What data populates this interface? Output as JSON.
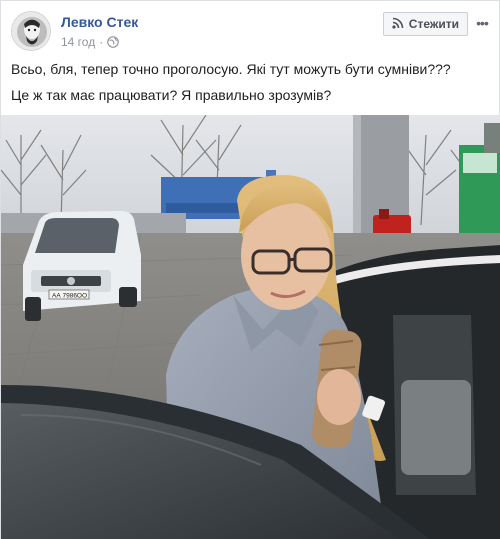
{
  "post": {
    "author": "Левко Стек",
    "time": "14 год",
    "follow_label": "Стежити",
    "more_icon": "more-dots-icon",
    "text_lines": [
      "Всьо, бля, тепер точно проголосую. Які тут можуть бути сумніви???",
      "Це ж так має працювати? Я правильно зрозумів?"
    ],
    "photo": {
      "car_plate": "АА 7986ОО"
    }
  },
  "colors": {
    "author_link": "#365899",
    "meta": "#90949c",
    "border": "#dddfe2"
  }
}
